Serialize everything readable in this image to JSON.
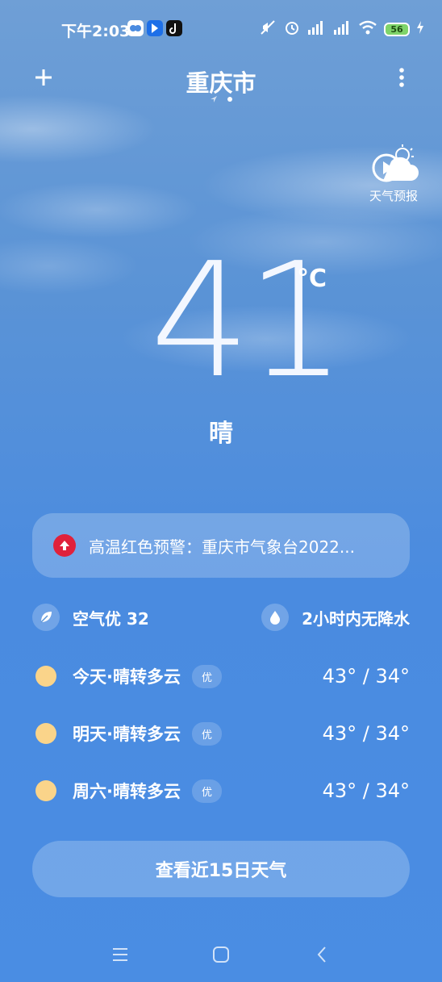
{
  "status_bar": {
    "time": "下午2:03",
    "battery": "56"
  },
  "header": {
    "city": "重庆市"
  },
  "forecast_video": {
    "label": "天气预报"
  },
  "current": {
    "temperature": "41",
    "unit": "°C",
    "condition": "晴"
  },
  "alert": {
    "text": "高温红色预警：重庆市气象台2022..."
  },
  "air": {
    "label": "空气优 32"
  },
  "rain": {
    "label": "2小时内无降水"
  },
  "daily": [
    {
      "label": "今天·晴转多云",
      "aqi": "优",
      "temp": "43° / 34°"
    },
    {
      "label": "明天·晴转多云",
      "aqi": "优",
      "temp": "43° / 34°"
    },
    {
      "label": "周六·晴转多云",
      "aqi": "优",
      "temp": "43° / 34°"
    }
  ],
  "fifteen_day_button": "查看近15日天气",
  "colors": {
    "alert_red": "#e0213b",
    "sun_yellow": "#fad48a",
    "battery_green": "#7fd46a"
  }
}
